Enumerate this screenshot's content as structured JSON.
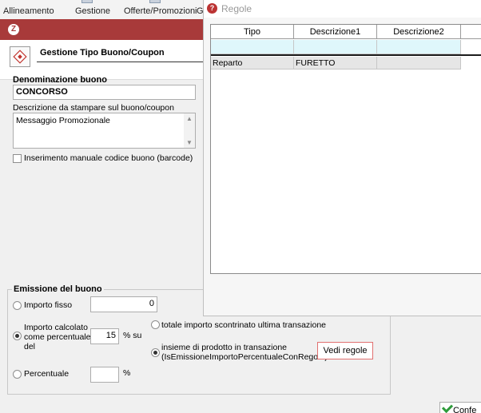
{
  "background_toolbar": {
    "items": [
      "Allineamento",
      "Gestione",
      "Offerte/Promozioni",
      "G"
    ]
  },
  "dialog": {
    "title_badge": "Z",
    "header_title": "Gestione Tipo Buono/Coupon",
    "denominazione_label": "Denominazione buono",
    "denominazione_value": "CONCORSO",
    "descrizione_label": "Descrizione da stampare sul buono/coupon",
    "descrizione_value": "Messaggio Promozionale",
    "inserimento_label": "Inserimento manuale codice buono (barcode)",
    "inserimento_checked": false
  },
  "emissione": {
    "group_title": "Emissione del buono",
    "importo_fisso_label": "Importo fisso",
    "importo_fisso_value": "0",
    "importo_calcolato_label_1": "Importo calcolato",
    "importo_calcolato_label_2": "come percentuale",
    "importo_calcolato_label_3": "del",
    "percent_value": "15",
    "percent_su": "% su",
    "totale_label": "totale importo scontrinato ultima transazione",
    "insieme_label_1": "insieme di prodotto in transazione",
    "insieme_label_2": "(IsEmissioneImportoPercentualeConRegole)",
    "vedi_regole": "Vedi regole",
    "percentuale_label": "Percentuale",
    "percentuale_value": "",
    "percentuale_unit": "%",
    "selected_option": "importo_calcolato",
    "selected_base": "insieme"
  },
  "confirm_button": "Confe",
  "regole": {
    "title_badge": "?",
    "title": "Regole",
    "columns": [
      "Tipo",
      "Descrizione1",
      "Descrizione2"
    ],
    "rows": [
      {
        "tipo": "Reparto",
        "descrizione1": "FURETTO",
        "descrizione2": ""
      }
    ]
  }
}
